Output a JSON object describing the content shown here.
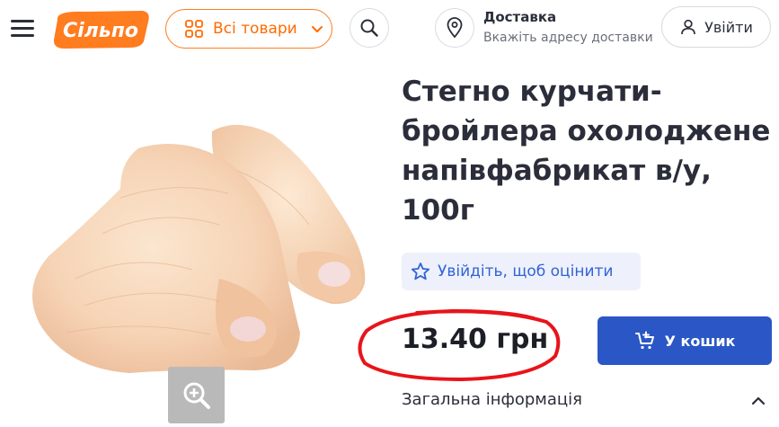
{
  "header": {
    "logo_text": "Сільпо",
    "catalog_label": "Всі товари",
    "delivery_title": "Доставка",
    "delivery_subtitle": "Вкажіть адресу доставки",
    "login_label": "Увійти"
  },
  "product": {
    "title": "Стегно курчати-бройлера охолоджене напівфабрикат в/у, 100г",
    "rating_prompt": "Увійдіть, щоб оцінити",
    "price": "13.40 грн",
    "add_to_cart_label": "У кошик",
    "info_section": "Загальна інформація"
  },
  "colors": {
    "brand_orange": "#ff7c1f",
    "primary_blue": "#2a57c5",
    "annotation_red": "#e8141b"
  },
  "icons": [
    "menu-icon",
    "grid-icon",
    "chevron-down-icon",
    "search-icon",
    "location-pin-icon",
    "user-icon",
    "star-icon",
    "cart-plus-icon",
    "zoom-in-icon",
    "chevron-up-icon"
  ]
}
